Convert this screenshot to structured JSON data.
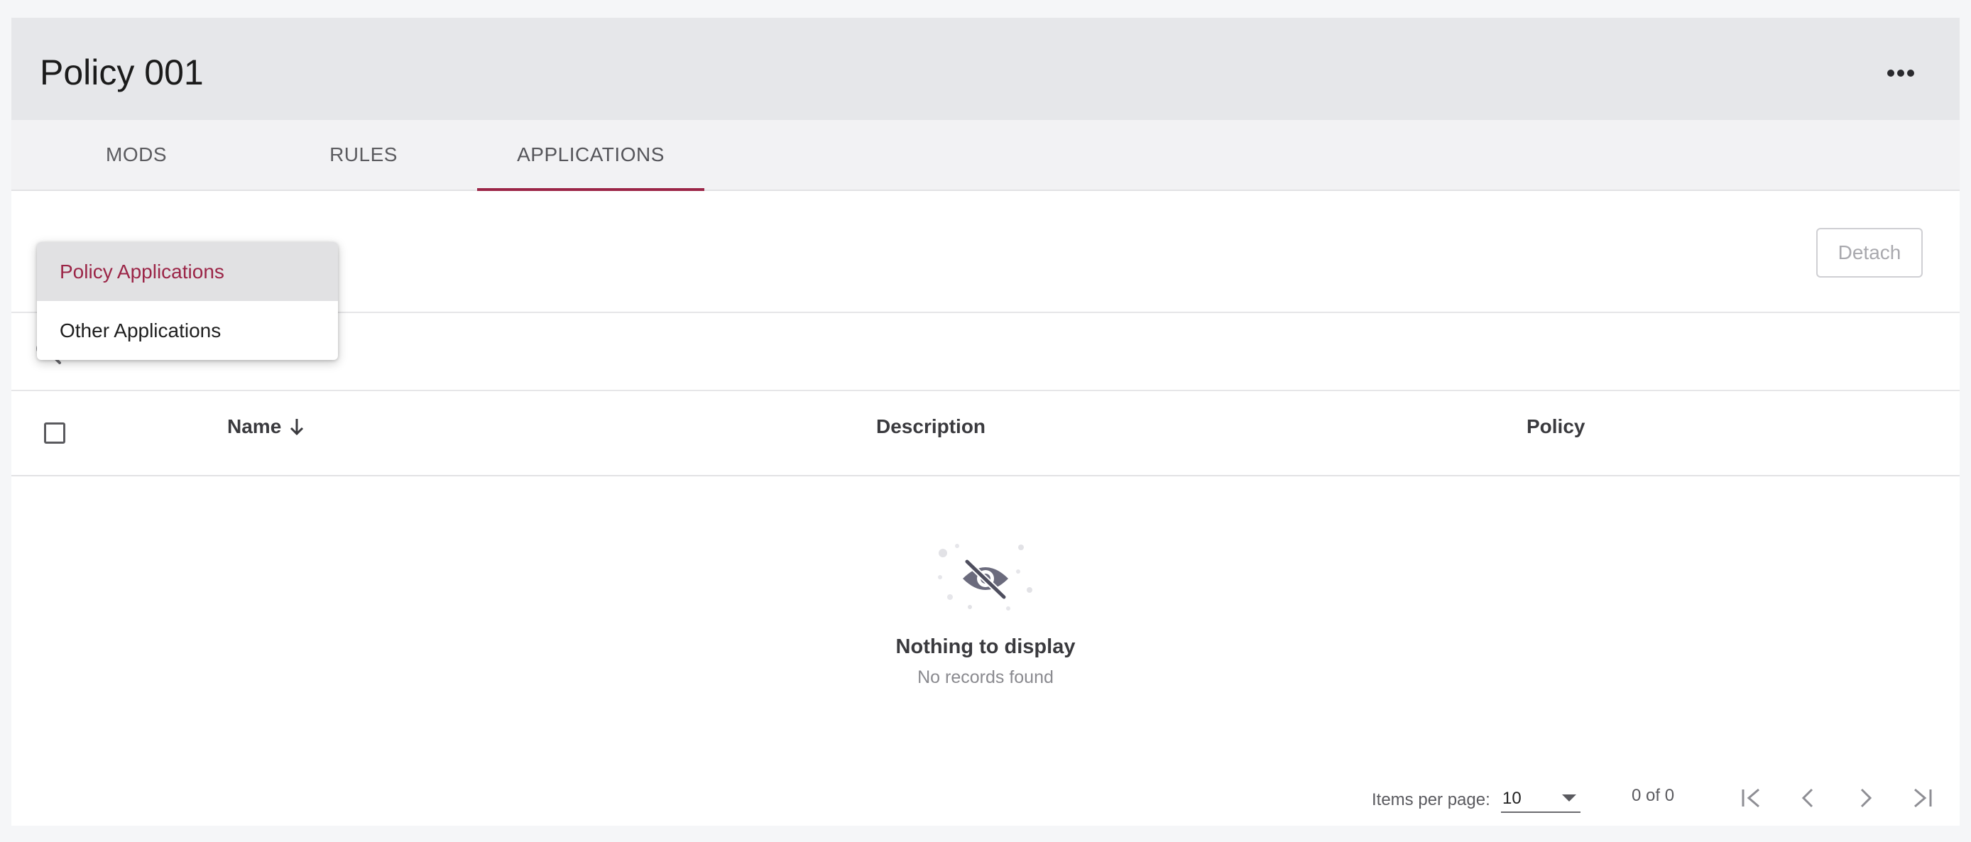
{
  "page": {
    "title": "Policy 001"
  },
  "header": {
    "more_icon": "more-horizontal-icon"
  },
  "tabs": [
    {
      "label": "MODS",
      "active": false
    },
    {
      "label": "RULES",
      "active": false
    },
    {
      "label": "APPLICATIONS",
      "active": true
    }
  ],
  "dropdown": {
    "items": [
      {
        "label": "Policy Applications",
        "selected": true
      },
      {
        "label": "Other Applications",
        "selected": false
      }
    ]
  },
  "toolbar": {
    "detach_label": "Detach"
  },
  "search": {
    "placeholder": "Search",
    "value": "",
    "icon": "search-icon"
  },
  "table": {
    "columns": [
      {
        "label": "Name",
        "sort": "descending"
      },
      {
        "label": "Description"
      },
      {
        "label": "Policy"
      }
    ],
    "rows": []
  },
  "empty_state": {
    "icon": "eye-off-icon",
    "title": "Nothing to display",
    "subtitle": "No records found"
  },
  "paginator": {
    "items_per_page_label": "Items per page:",
    "items_per_page": "10",
    "range": "0 of 0"
  },
  "colors": {
    "accent": "#9b2547",
    "header_bg": "#e6e7ea",
    "tabs_bg": "#f2f2f4"
  }
}
